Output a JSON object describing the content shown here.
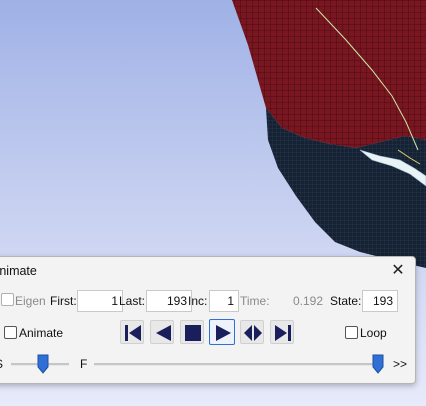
{
  "dialog": {
    "title": "Animate",
    "close_glyph": "✕",
    "row1": {
      "eigen_label": "Eigen",
      "eigen_checked": false,
      "eigen_enabled": false,
      "first_label": "First:",
      "first_value": "1",
      "last_label": "Last:",
      "last_value": "193",
      "inc_label": "Inc:",
      "inc_value": "1",
      "time_label": "Time:",
      "time_value": "0.192",
      "state_label": "State:",
      "state_value": "193"
    },
    "row2": {
      "animate_label": "Animate",
      "animate_checked": false,
      "loop_label": "Loop",
      "loop_checked": false,
      "buttons": [
        "rewind-to-start-icon",
        "step-backward-icon",
        "stop-icon",
        "play-forward-icon",
        "play-reverse-forward-icon",
        "skip-to-end-icon"
      ],
      "active_button": "play-forward-icon"
    },
    "row3": {
      "s_label": "S",
      "f_label": "F",
      "more_label": ">>",
      "s_slider_fraction": 0.55,
      "f_slider_fraction": 1.0
    }
  },
  "colors": {
    "mesh_red": "#7a1620",
    "mesh_dark": "#141f2e",
    "accent": "#2f6fd6",
    "media_icon": "#1a1f5c"
  }
}
